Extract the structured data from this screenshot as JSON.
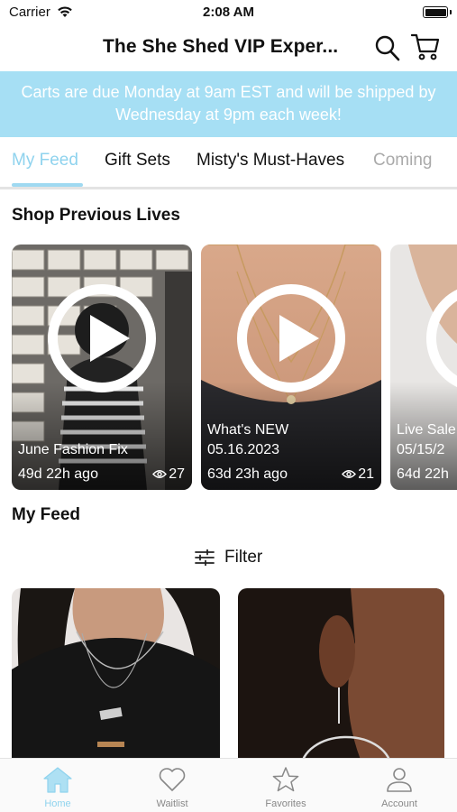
{
  "status_bar": {
    "carrier": "Carrier",
    "time": "2:08 AM"
  },
  "header": {
    "title": "The She Shed  VIP Exper..."
  },
  "banner": {
    "text": "Carts are due Monday at 9am EST and will be shipped by Wednesday at 9pm each week!"
  },
  "tabs": [
    {
      "label": "My Feed",
      "active": true
    },
    {
      "label": "Gift Sets"
    },
    {
      "label": "Misty's Must-Haves"
    },
    {
      "label": "Coming"
    }
  ],
  "previous_lives": {
    "title": "Shop Previous Lives",
    "items": [
      {
        "name": "June Fashion Fix",
        "ago": "49d 22h ago",
        "views": "27"
      },
      {
        "name": "What's NEW\n05.16.2023",
        "ago": "63d 23h ago",
        "views": "21"
      },
      {
        "name": "Live Sale\n05/15/2",
        "ago": "64d 22h",
        "views": ""
      }
    ]
  },
  "feed": {
    "title": "My Feed",
    "filter_label": "Filter"
  },
  "bottom_nav": [
    {
      "label": "Home",
      "icon": "home-icon",
      "active": true
    },
    {
      "label": "Waitlist",
      "icon": "heart-icon"
    },
    {
      "label": "Favorites",
      "icon": "star-icon"
    },
    {
      "label": "Account",
      "icon": "person-icon"
    }
  ],
  "colors": {
    "accent": "#8fd3ee",
    "banner": "#a6dff4"
  }
}
